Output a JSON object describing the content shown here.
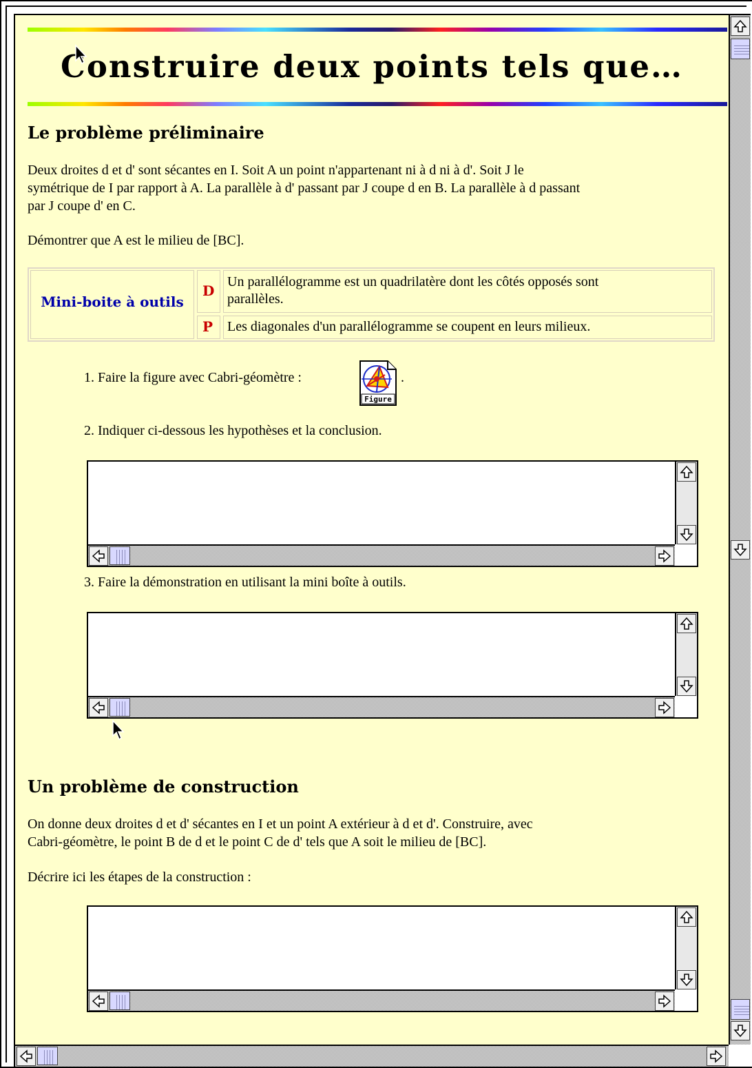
{
  "page": {
    "title": "Construire deux points tels que…"
  },
  "section1": {
    "heading": "Le problème préliminaire",
    "problem_lines": [
      "Deux droites d et d' sont sécantes en I. Soit A un point n'appartenant ni à d ni à d'. Soit J le",
      "symétrique de I par rapport à A. La parallèle à d' passant par J coupe d en B. La parallèle à d passant",
      "par J coupe d' en C."
    ],
    "prove": "Démontrer que A est le milieu de [BC]."
  },
  "toolbox": {
    "title": "Mini-boite à outils",
    "items": [
      {
        "tag": "D",
        "lines": [
          "Un parallélogramme est un quadrilatère dont les côtés opposés sont",
          "parallèles."
        ]
      },
      {
        "tag": "P",
        "lines": [
          "Les diagonales d'un parallélogramme se coupent en leurs milieux."
        ]
      }
    ]
  },
  "steps": {
    "step1_prefix": "1. Faire la figure avec Cabri-géomètre : ",
    "step1_suffix": ".",
    "figure_label": "Figure",
    "step2": "2. Indiquer ci-dessous les hypothèses et la conclusion.",
    "step3": "3. Faire la démonstration en utilisant la mini boîte à outils."
  },
  "section2": {
    "heading": "Un problème de construction",
    "problem_lines": [
      "On donne deux droites d et d' sécantes en I et un point A extérieur à d et d'. Construire, avec",
      "Cabri-géomètre, le point B de d et le point C de d' tels que A soit le milieu de [BC]."
    ],
    "describe": "Décrire ici les étapes de la construction :"
  },
  "textareas": {
    "hypotheses_value": "",
    "demonstration_value": "",
    "construction_value": ""
  },
  "colors": {
    "page_background": "#ffffcc",
    "toolbox_title": "#0000aa",
    "toolbox_tag": "#c80000"
  },
  "icons": [
    "arrow-up-icon",
    "arrow-down-icon",
    "arrow-left-icon",
    "arrow-right-icon",
    "figure-document-icon",
    "mouse-pointer-icon"
  ]
}
